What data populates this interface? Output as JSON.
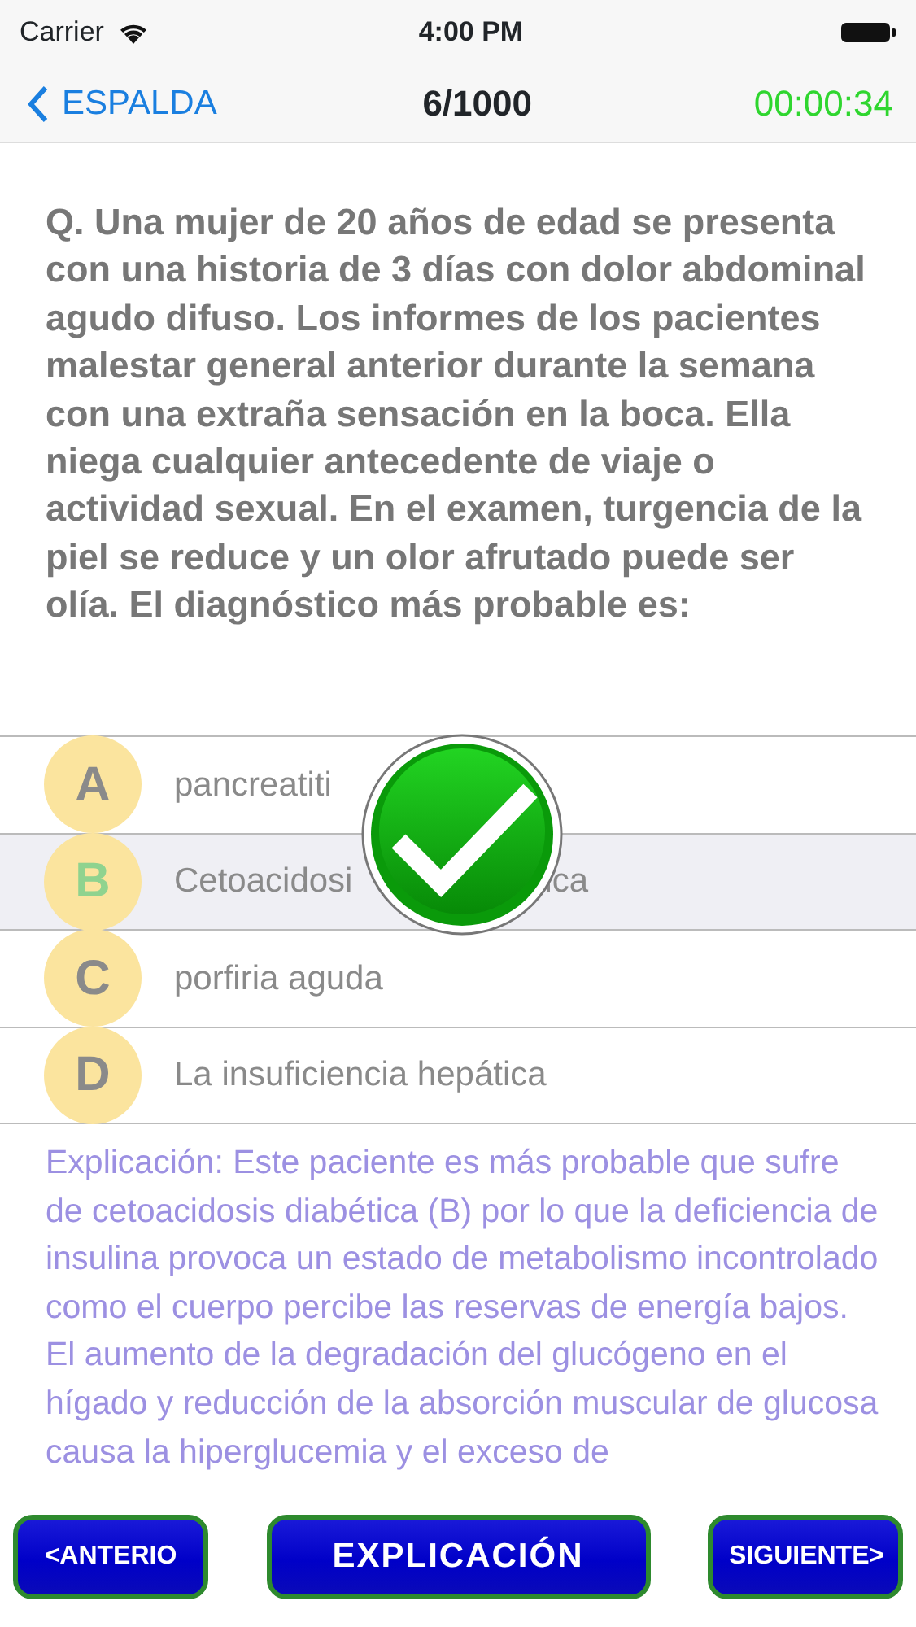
{
  "status_bar": {
    "carrier": "Carrier",
    "time": "4:00 PM"
  },
  "nav": {
    "back": "ESPALDA",
    "counter": "6/1000",
    "timer": "00:00:34"
  },
  "question": "Q. Una mujer de 20 años de edad se presenta con una historia de 3 días con dolor abdominal agudo difuso. Los informes de los pacientes malestar general anterior durante la semana con una extraña sensación en la boca. Ella niega cualquier antecedente de viaje o actividad sexual. En el examen, turgencia de la piel se reduce y un olor afrutado puede ser olía. El diagnóstico más probable es:",
  "options": [
    {
      "letter": "A",
      "text": "pancreatiti",
      "selected": false,
      "correct": false
    },
    {
      "letter": "B",
      "text": "Cetoacidosi",
      "text_after_overlay": "ica",
      "selected": true,
      "correct": true
    },
    {
      "letter": "C",
      "text": "porfiria aguda",
      "selected": false,
      "correct": false
    },
    {
      "letter": "D",
      "text": "La insuficiencia hepática",
      "selected": false,
      "correct": false
    }
  ],
  "result": {
    "correct": true
  },
  "explanation": "Explicación: Este paciente es más probable que sufre de cetoacidosis diabética (B) por lo que la deficiencia de insulina provoca un estado de metabolismo incontrolado como el cuerpo percibe las reservas de energía bajos. El aumento de la degradación del glucógeno en el hígado y reducción de la absorción muscular de glucosa causa la hiperglucemia y el exceso de",
  "buttons": {
    "previous": "<ANTERIO",
    "explain": "EXPLICACIÓN",
    "next": "SIGUIENTE>"
  }
}
